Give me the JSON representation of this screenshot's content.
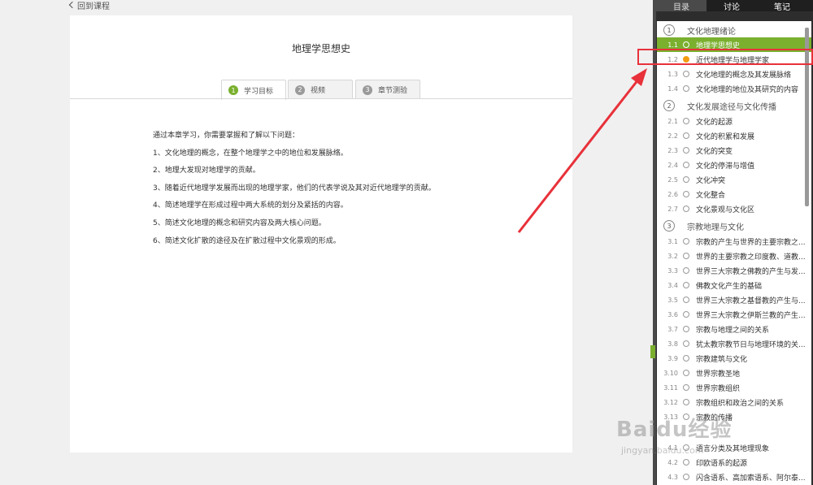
{
  "back_label": "回到课程",
  "page_title": "地理学思想史",
  "tabs": [
    {
      "num": "1",
      "label": "学习目标"
    },
    {
      "num": "2",
      "label": "视频"
    },
    {
      "num": "3",
      "label": "章节测验"
    }
  ],
  "content": {
    "intro": "通过本章学习，你需要掌握和了解以下问题：",
    "items": [
      "1、文化地理的概念，在整个地理学之中的地位和发展脉络。",
      "2、地理大发现对地理学的贡献。",
      "3、随着近代地理学发展而出现的地理学家，他们的代表学说及其对近代地理学的贡献。",
      "4、简述地理学在形成过程中两大系统的划分及紧括的内容。",
      "5、简述文化地理的概念和研究内容及两大核心问题。",
      "6、简述文化扩散的途径及在扩散过程中文化景观的形成。"
    ]
  },
  "panel": {
    "tabs": [
      "目录",
      "讨论",
      "笔记"
    ],
    "chapters": [
      {
        "num": "1",
        "title": "文化地理绪论"
      },
      {
        "num": "2",
        "title": "文化发展途径与文化传播"
      },
      {
        "num": "3",
        "title": "宗教地理与文化"
      }
    ],
    "rows": [
      {
        "num": "1.1",
        "title": "地理学思想史"
      },
      {
        "num": "1.2",
        "title": "近代地理学与地理学家"
      },
      {
        "num": "1.3",
        "title": "文化地理的概念及其发展脉络"
      },
      {
        "num": "1.4",
        "title": "文化地理的地位及其研究的内容"
      },
      {
        "num": "2.1",
        "title": "文化的起源"
      },
      {
        "num": "2.2",
        "title": "文化的积累和发展"
      },
      {
        "num": "2.3",
        "title": "文化的突变"
      },
      {
        "num": "2.4",
        "title": "文化的停滞与增值"
      },
      {
        "num": "2.5",
        "title": "文化冲突"
      },
      {
        "num": "2.6",
        "title": "文化整合"
      },
      {
        "num": "2.7",
        "title": "文化景观与文化区"
      },
      {
        "num": "3.1",
        "title": "宗教的产生与世界的主要宗教之..."
      },
      {
        "num": "3.2",
        "title": "世界的主要宗教之印度教、道教..."
      },
      {
        "num": "3.3",
        "title": "世界三大宗教之佛教的产生与发..."
      },
      {
        "num": "3.4",
        "title": "佛教文化产生的基础"
      },
      {
        "num": "3.5",
        "title": "世界三大宗教之基督教的产生与..."
      },
      {
        "num": "3.6",
        "title": "世界三大宗教之伊斯兰教的产生..."
      },
      {
        "num": "3.7",
        "title": "宗教与地理之间的关系"
      },
      {
        "num": "3.8",
        "title": "犹太教宗教节日与地理环境的关..."
      },
      {
        "num": "3.9",
        "title": "宗教建筑与文化"
      },
      {
        "num": "3.10",
        "title": "世界宗教圣地"
      },
      {
        "num": "3.11",
        "title": "世界宗教组织"
      },
      {
        "num": "3.12",
        "title": "宗教组织和政治之间的关系"
      },
      {
        "num": "3.13",
        "title": "宗教的传播"
      },
      {
        "num": "4.1",
        "title": "语言分类及其地理现象"
      },
      {
        "num": "4.2",
        "title": "印欧语系的起源"
      },
      {
        "num": "4.3",
        "title": "闪含语系、高加索语系、阿尔泰..."
      }
    ]
  },
  "watermark": "Baidu经验",
  "watermark_sub": "jingyan.baidu.com",
  "colors": {
    "accent": "#7ab02e",
    "highlight": "#e8313a",
    "current_dot": "#f39c12"
  }
}
